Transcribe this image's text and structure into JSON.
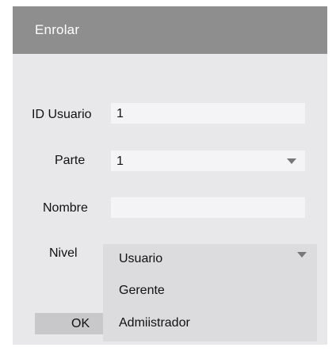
{
  "dialog": {
    "title": "Enrolar"
  },
  "form": {
    "id_usuario": {
      "label": "ID Usuario",
      "value": "1"
    },
    "parte": {
      "label": "Parte",
      "value": "1"
    },
    "nombre": {
      "label": "Nombre",
      "value": ""
    },
    "nivel": {
      "label": "Nivel",
      "selected": "Usuario",
      "options": [
        "Usuario",
        "Gerente",
        "Admiistrador"
      ]
    }
  },
  "buttons": {
    "ok_label": "OK"
  },
  "icons": {
    "dropdown_arrow": "chevron-down-icon"
  }
}
